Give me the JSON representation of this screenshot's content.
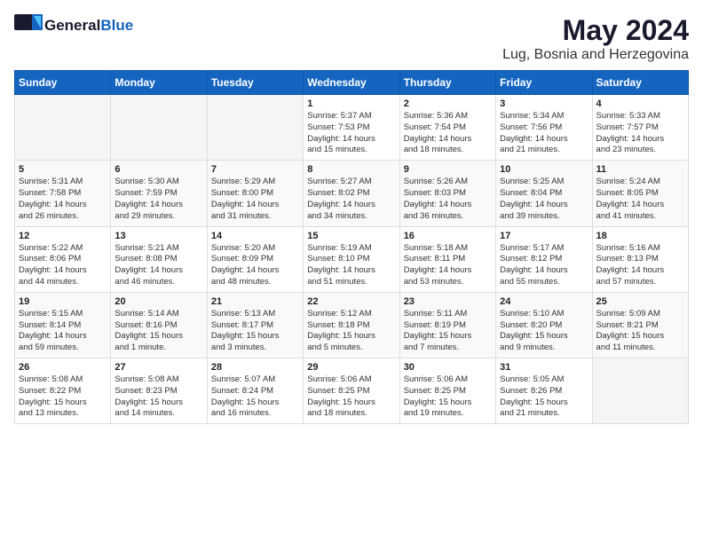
{
  "logo": {
    "general": "General",
    "blue": "Blue"
  },
  "title": "May 2024",
  "location": "Lug, Bosnia and Herzegovina",
  "days_of_week": [
    "Sunday",
    "Monday",
    "Tuesday",
    "Wednesday",
    "Thursday",
    "Friday",
    "Saturday"
  ],
  "weeks": [
    [
      {
        "day": "",
        "info": ""
      },
      {
        "day": "",
        "info": ""
      },
      {
        "day": "",
        "info": ""
      },
      {
        "day": "1",
        "info": "Sunrise: 5:37 AM\nSunset: 7:53 PM\nDaylight: 14 hours\nand 15 minutes."
      },
      {
        "day": "2",
        "info": "Sunrise: 5:36 AM\nSunset: 7:54 PM\nDaylight: 14 hours\nand 18 minutes."
      },
      {
        "day": "3",
        "info": "Sunrise: 5:34 AM\nSunset: 7:56 PM\nDaylight: 14 hours\nand 21 minutes."
      },
      {
        "day": "4",
        "info": "Sunrise: 5:33 AM\nSunset: 7:57 PM\nDaylight: 14 hours\nand 23 minutes."
      }
    ],
    [
      {
        "day": "5",
        "info": "Sunrise: 5:31 AM\nSunset: 7:58 PM\nDaylight: 14 hours\nand 26 minutes."
      },
      {
        "day": "6",
        "info": "Sunrise: 5:30 AM\nSunset: 7:59 PM\nDaylight: 14 hours\nand 29 minutes."
      },
      {
        "day": "7",
        "info": "Sunrise: 5:29 AM\nSunset: 8:00 PM\nDaylight: 14 hours\nand 31 minutes."
      },
      {
        "day": "8",
        "info": "Sunrise: 5:27 AM\nSunset: 8:02 PM\nDaylight: 14 hours\nand 34 minutes."
      },
      {
        "day": "9",
        "info": "Sunrise: 5:26 AM\nSunset: 8:03 PM\nDaylight: 14 hours\nand 36 minutes."
      },
      {
        "day": "10",
        "info": "Sunrise: 5:25 AM\nSunset: 8:04 PM\nDaylight: 14 hours\nand 39 minutes."
      },
      {
        "day": "11",
        "info": "Sunrise: 5:24 AM\nSunset: 8:05 PM\nDaylight: 14 hours\nand 41 minutes."
      }
    ],
    [
      {
        "day": "12",
        "info": "Sunrise: 5:22 AM\nSunset: 8:06 PM\nDaylight: 14 hours\nand 44 minutes."
      },
      {
        "day": "13",
        "info": "Sunrise: 5:21 AM\nSunset: 8:08 PM\nDaylight: 14 hours\nand 46 minutes."
      },
      {
        "day": "14",
        "info": "Sunrise: 5:20 AM\nSunset: 8:09 PM\nDaylight: 14 hours\nand 48 minutes."
      },
      {
        "day": "15",
        "info": "Sunrise: 5:19 AM\nSunset: 8:10 PM\nDaylight: 14 hours\nand 51 minutes."
      },
      {
        "day": "16",
        "info": "Sunrise: 5:18 AM\nSunset: 8:11 PM\nDaylight: 14 hours\nand 53 minutes."
      },
      {
        "day": "17",
        "info": "Sunrise: 5:17 AM\nSunset: 8:12 PM\nDaylight: 14 hours\nand 55 minutes."
      },
      {
        "day": "18",
        "info": "Sunrise: 5:16 AM\nSunset: 8:13 PM\nDaylight: 14 hours\nand 57 minutes."
      }
    ],
    [
      {
        "day": "19",
        "info": "Sunrise: 5:15 AM\nSunset: 8:14 PM\nDaylight: 14 hours\nand 59 minutes."
      },
      {
        "day": "20",
        "info": "Sunrise: 5:14 AM\nSunset: 8:16 PM\nDaylight: 15 hours\nand 1 minute."
      },
      {
        "day": "21",
        "info": "Sunrise: 5:13 AM\nSunset: 8:17 PM\nDaylight: 15 hours\nand 3 minutes."
      },
      {
        "day": "22",
        "info": "Sunrise: 5:12 AM\nSunset: 8:18 PM\nDaylight: 15 hours\nand 5 minutes."
      },
      {
        "day": "23",
        "info": "Sunrise: 5:11 AM\nSunset: 8:19 PM\nDaylight: 15 hours\nand 7 minutes."
      },
      {
        "day": "24",
        "info": "Sunrise: 5:10 AM\nSunset: 8:20 PM\nDaylight: 15 hours\nand 9 minutes."
      },
      {
        "day": "25",
        "info": "Sunrise: 5:09 AM\nSunset: 8:21 PM\nDaylight: 15 hours\nand 11 minutes."
      }
    ],
    [
      {
        "day": "26",
        "info": "Sunrise: 5:08 AM\nSunset: 8:22 PM\nDaylight: 15 hours\nand 13 minutes."
      },
      {
        "day": "27",
        "info": "Sunrise: 5:08 AM\nSunset: 8:23 PM\nDaylight: 15 hours\nand 14 minutes."
      },
      {
        "day": "28",
        "info": "Sunrise: 5:07 AM\nSunset: 8:24 PM\nDaylight: 15 hours\nand 16 minutes."
      },
      {
        "day": "29",
        "info": "Sunrise: 5:06 AM\nSunset: 8:25 PM\nDaylight: 15 hours\nand 18 minutes."
      },
      {
        "day": "30",
        "info": "Sunrise: 5:06 AM\nSunset: 8:25 PM\nDaylight: 15 hours\nand 19 minutes."
      },
      {
        "day": "31",
        "info": "Sunrise: 5:05 AM\nSunset: 8:26 PM\nDaylight: 15 hours\nand 21 minutes."
      },
      {
        "day": "",
        "info": ""
      }
    ]
  ]
}
